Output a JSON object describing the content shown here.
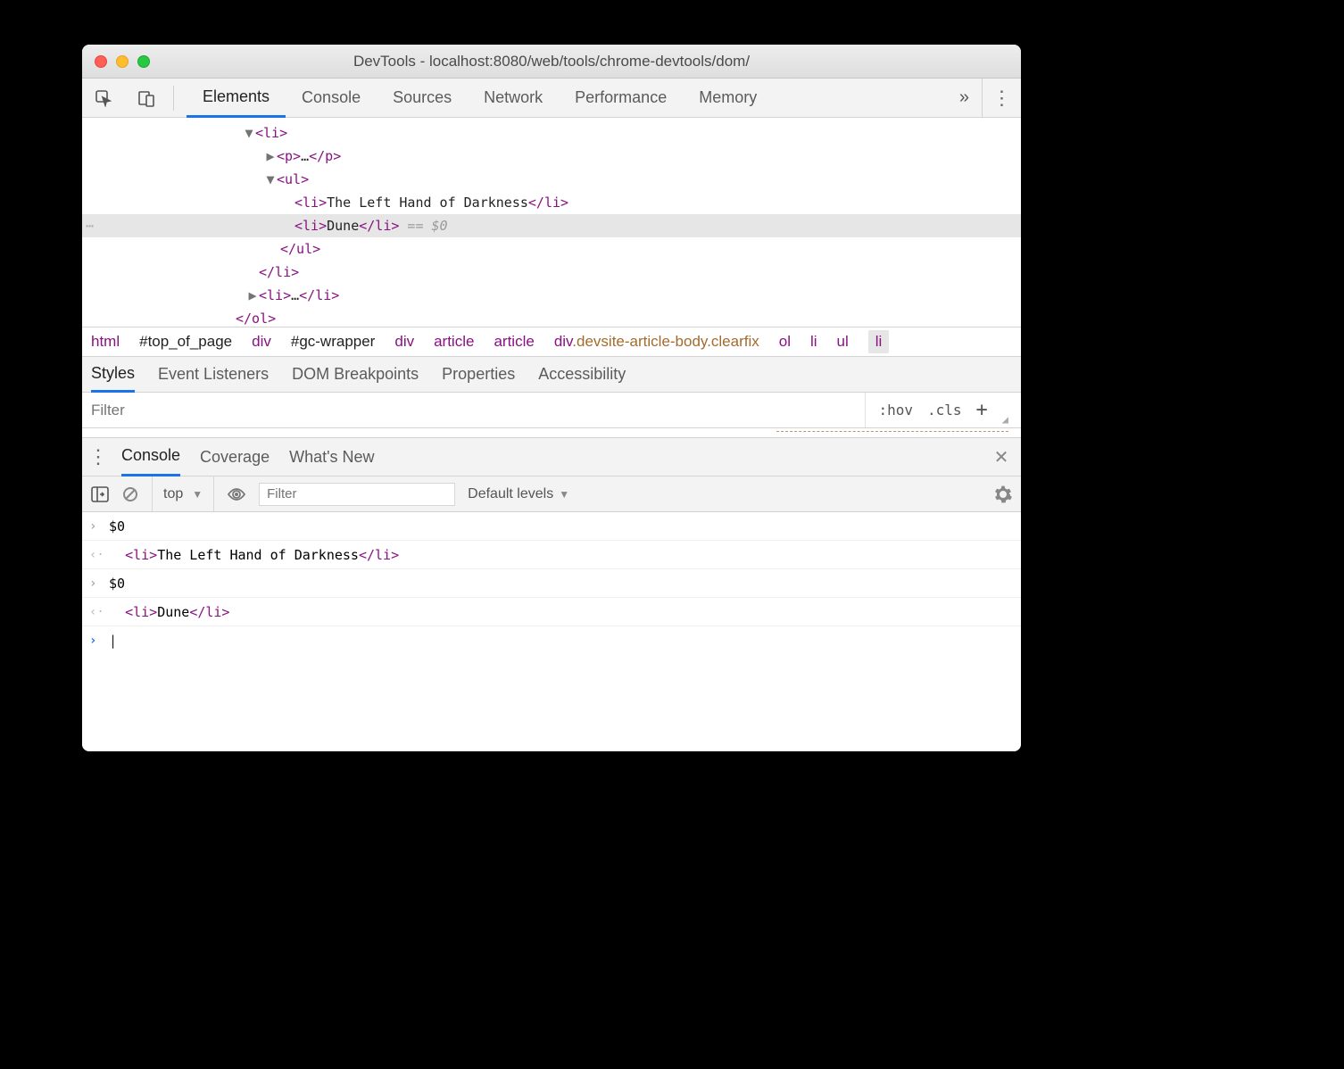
{
  "window": {
    "title": "DevTools - localhost:8080/web/tools/chrome-devtools/dom/"
  },
  "main_tabs": {
    "items": [
      "Elements",
      "Console",
      "Sources",
      "Network",
      "Performance",
      "Memory"
    ],
    "active_index": 0
  },
  "dom_tree": {
    "lines": [
      {
        "indent": 180,
        "disc": "▼",
        "html_pre": "<li>",
        "text": "",
        "html_post": ""
      },
      {
        "indent": 204,
        "disc": "▶",
        "html_pre": "<p>",
        "text": "…",
        "html_post": "</p>"
      },
      {
        "indent": 204,
        "disc": "▼",
        "html_pre": "<ul>",
        "text": "",
        "html_post": ""
      },
      {
        "indent": 238,
        "disc": "",
        "html_pre": "<li>",
        "text": "The Left Hand of Darkness",
        "html_post": "</li>"
      },
      {
        "indent": 238,
        "disc": "",
        "html_pre": "<li>",
        "text": "Dune",
        "html_post": "</li>",
        "selected": true,
        "eq_marker": " == $0"
      },
      {
        "indent": 222,
        "disc": "",
        "html_pre": "</ul>",
        "text": "",
        "html_post": ""
      },
      {
        "indent": 198,
        "disc": "",
        "html_pre": "</li>",
        "text": "",
        "html_post": ""
      },
      {
        "indent": 184,
        "disc": "▶",
        "html_pre": "<li>",
        "text": "…",
        "html_post": "</li>"
      },
      {
        "indent": 172,
        "disc": "",
        "html_pre": "</ol>",
        "text": "",
        "html_post": ""
      }
    ]
  },
  "breadcrumbs": {
    "items": [
      {
        "label": "html",
        "style": "tag"
      },
      {
        "label": "#top_of_page",
        "style": "black"
      },
      {
        "label": "div",
        "style": "tag"
      },
      {
        "label": "#gc-wrapper",
        "style": "black"
      },
      {
        "label": "div",
        "style": "tag"
      },
      {
        "label": "article",
        "style": "tag"
      },
      {
        "label": "article",
        "style": "tag"
      },
      {
        "label": "div.devsite-article-body.clearfix",
        "style": "brown-compound"
      },
      {
        "label": "ol",
        "style": "tag"
      },
      {
        "label": "li",
        "style": "tag"
      },
      {
        "label": "ul",
        "style": "tag"
      },
      {
        "label": "li",
        "style": "tag",
        "selected": true
      }
    ]
  },
  "styles_tabs": {
    "items": [
      "Styles",
      "Event Listeners",
      "DOM Breakpoints",
      "Properties",
      "Accessibility"
    ],
    "active_index": 0
  },
  "filter": {
    "placeholder": "Filter",
    "hov": ":hov",
    "cls": ".cls"
  },
  "drawer_tabs": {
    "items": [
      "Console",
      "Coverage",
      "What's New"
    ],
    "active_index": 0
  },
  "console_ctl": {
    "context": "top",
    "filter_placeholder": "Filter",
    "levels": "Default levels"
  },
  "console_lines": [
    {
      "kind": "in",
      "mark": "›",
      "pre": "",
      "text": "$0",
      "post": ""
    },
    {
      "kind": "out-node",
      "mark": "‹·",
      "indent": "  ",
      "pre": "<li>",
      "text": "The Left Hand of Darkness",
      "post": "</li>"
    },
    {
      "kind": "in",
      "mark": "›",
      "pre": "",
      "text": "$0",
      "post": ""
    },
    {
      "kind": "out-node",
      "mark": "‹·",
      "indent": "  ",
      "pre": "<li>",
      "text": "Dune",
      "post": "</li>"
    }
  ],
  "prompt_marker": "›"
}
